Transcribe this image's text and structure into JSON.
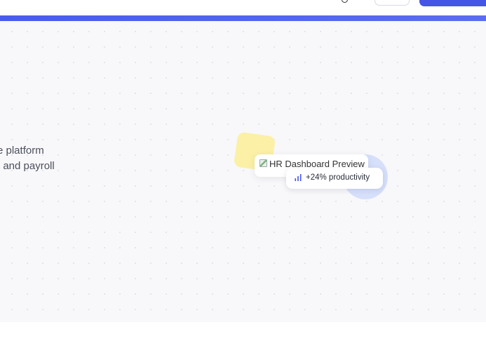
{
  "header": {
    "accent_color": "#4a5bec"
  },
  "hero": {
    "text_lines": [
      "e platform",
      ", and payroll"
    ],
    "preview_alt": "HR Dashboard Preview",
    "badge": {
      "icon": "bar-chart-icon",
      "label": "+24% productivity"
    },
    "colors": {
      "background": "#f8f8fa",
      "yellow_accent": "#fbf0a6",
      "blue_accent": "#d6e0fa"
    }
  }
}
